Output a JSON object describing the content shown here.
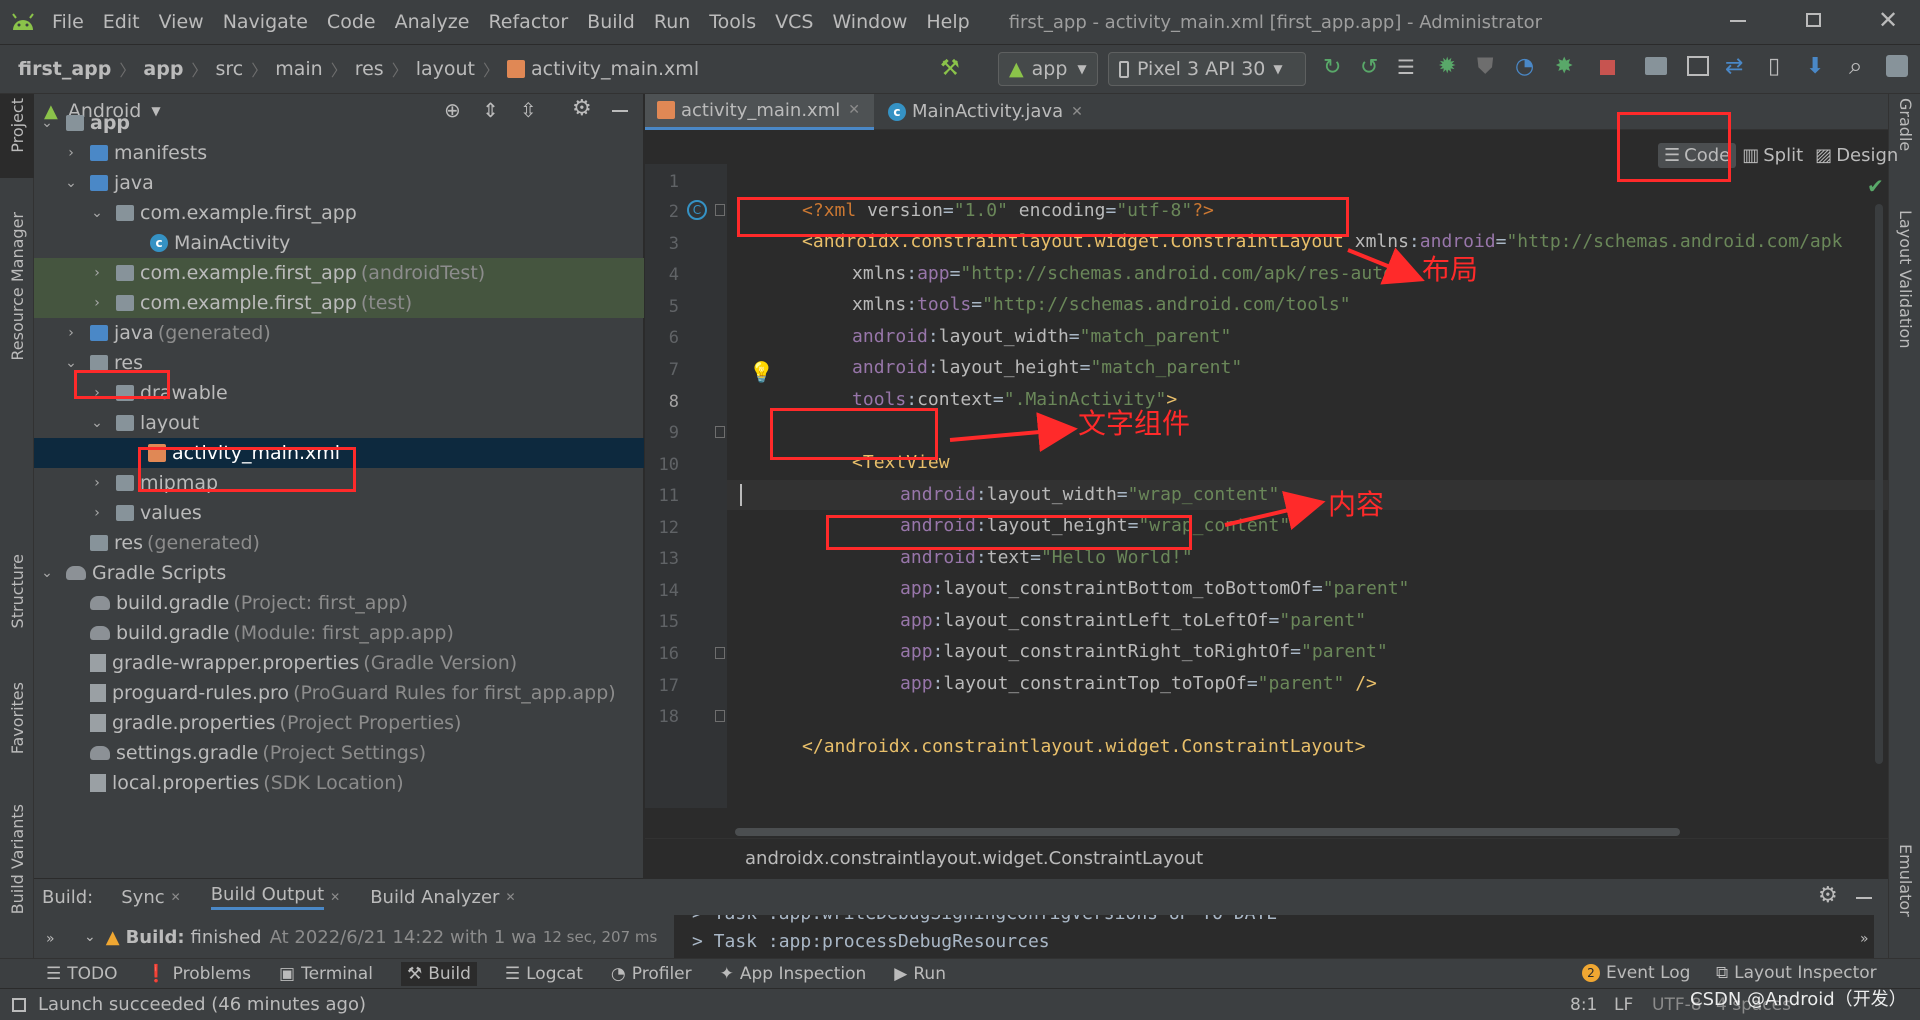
{
  "menu": {
    "items": [
      "File",
      "Edit",
      "View",
      "Navigate",
      "Code",
      "Analyze",
      "Refactor",
      "Build",
      "Run",
      "Tools",
      "VCS",
      "Window",
      "Help"
    ],
    "title": "first_app - activity_main.xml [first_app.app] - Administrator"
  },
  "breadcrumb": [
    "first_app",
    "app",
    "src",
    "main",
    "res",
    "layout",
    "activity_main.xml"
  ],
  "toolbar": {
    "run_config": "app",
    "device": "Pixel 3 API 30"
  },
  "left_tool_windows": [
    "Project",
    "Resource Manager",
    "Structure",
    "Favorites",
    "Build Variants"
  ],
  "right_tool_windows": [
    "Gradle",
    "Layout Validation",
    "Emulator"
  ],
  "project_panel": {
    "view": "Android",
    "tree": [
      {
        "label": "app",
        "dim": ""
      },
      {
        "label": "manifests",
        "dim": ""
      },
      {
        "label": "java",
        "dim": ""
      },
      {
        "label": "com.example.first_app",
        "dim": ""
      },
      {
        "label": "MainActivity",
        "dim": ""
      },
      {
        "label": "com.example.first_app",
        "dim": "(androidTest)"
      },
      {
        "label": "com.example.first_app",
        "dim": "(test)"
      },
      {
        "label": "java",
        "dim": "(generated)"
      },
      {
        "label": "res",
        "dim": ""
      },
      {
        "label": "drawable",
        "dim": ""
      },
      {
        "label": "layout",
        "dim": ""
      },
      {
        "label": "activity_main.xml",
        "dim": ""
      },
      {
        "label": "mipmap",
        "dim": ""
      },
      {
        "label": "values",
        "dim": ""
      },
      {
        "label": "res",
        "dim": "(generated)"
      },
      {
        "label": "Gradle Scripts",
        "dim": ""
      },
      {
        "label": "build.gradle",
        "dim": "(Project: first_app)"
      },
      {
        "label": "build.gradle",
        "dim": "(Module: first_app.app)"
      },
      {
        "label": "gradle-wrapper.properties",
        "dim": "(Gradle Version)"
      },
      {
        "label": "proguard-rules.pro",
        "dim": "(ProGuard Rules for first_app.app)"
      },
      {
        "label": "gradle.properties",
        "dim": "(Project Properties)"
      },
      {
        "label": "settings.gradle",
        "dim": "(Project Settings)"
      },
      {
        "label": "local.properties",
        "dim": "(SDK Location)"
      }
    ]
  },
  "editor": {
    "tabs": [
      "activity_main.xml",
      "MainActivity.java"
    ],
    "view_modes": [
      "Code",
      "Split",
      "Design"
    ],
    "line_numbers": [
      "1",
      "2",
      "3",
      "4",
      "5",
      "6",
      "7",
      "8",
      "9",
      "10",
      "11",
      "12",
      "13",
      "14",
      "15",
      "16",
      "17",
      "18"
    ],
    "code": {
      "l1": {
        "a": "<?xml ",
        "b": "version",
        "c": "=",
        "d": "\"1.0\"",
        "e": " encoding",
        "f": "=",
        "g": "\"utf-8\"",
        "h": "?>"
      },
      "l2": {
        "tag": "<androidx.constraintlayout.widget.ConstraintLayout",
        "ns": " xmlns",
        "col": ":",
        "attr": "android",
        "eq": "=",
        "val": "\"http://schemas.android.com/apk"
      },
      "l3": {
        "ns": "xmlns",
        "col": ":",
        "attr": "app",
        "eq": "=",
        "val": "\"http://schemas.android.com/apk/res-auto\""
      },
      "l4": {
        "ns": "xmlns",
        "col": ":",
        "attr": "tools",
        "eq": "=",
        "val": "\"http://schemas.android.com/tools\""
      },
      "l5": {
        "ns": "android",
        "col": ":",
        "attr": "layout_width",
        "eq": "=",
        "val": "\"match_parent\""
      },
      "l6": {
        "ns": "android",
        "col": ":",
        "attr": "layout_height",
        "eq": "=",
        "val": "\"match_parent\""
      },
      "l7": {
        "ns": "tools",
        "col": ":",
        "attr": "context",
        "eq": "=",
        "val": "\".MainActivity\"",
        "tag": ">"
      },
      "l9": {
        "tag": "<TextView"
      },
      "l10": {
        "ns": "android",
        "col": ":",
        "attr": "layout_width",
        "eq": "=",
        "val": "\"wrap_content\""
      },
      "l11": {
        "ns": "android",
        "col": ":",
        "attr": "layout_height",
        "eq": "=",
        "val": "\"wrap_content\""
      },
      "l12": {
        "ns": "android",
        "col": ":",
        "attr": "text",
        "eq": "=",
        "val": "\"Hello World!\""
      },
      "l13": {
        "ns": "app",
        "col": ":",
        "attr": "layout_constraintBottom_toBottomOf",
        "eq": "=",
        "val": "\"parent\""
      },
      "l14": {
        "ns": "app",
        "col": ":",
        "attr": "layout_constraintLeft_toLeftOf",
        "eq": "=",
        "val": "\"parent\""
      },
      "l15": {
        "ns": "app",
        "col": ":",
        "attr": "layout_constraintRight_toRightOf",
        "eq": "=",
        "val": "\"parent\""
      },
      "l16": {
        "ns": "app",
        "col": ":",
        "attr": "layout_constraintTop_toTopOf",
        "eq": "=",
        "val": "\"parent\"",
        "tag": " />"
      },
      "l18": {
        "tag": "</androidx.constraintlayout.widget.ConstraintLayout>"
      }
    },
    "status_path": "androidx.constraintlayout.widget.ConstraintLayout"
  },
  "annotations": {
    "layout": "布局",
    "textview": "文字组件",
    "content": "内容"
  },
  "build_panel": {
    "label": "Build:",
    "tabs": [
      "Sync",
      "Build Output",
      "Build Analyzer"
    ],
    "status_bold": "Build:",
    "status": "finished",
    "status_detail": "At 2022/6/21 14:22 with 1 wa",
    "status_time": "12 sec, 207 ms",
    "log_top": "> Task :app:writeDebugSigningConfigVersions UP-TO-DATE",
    "log": "> Task :app:processDebugResources"
  },
  "bottom_tools": {
    "left": [
      "TODO",
      "Problems",
      "Terminal",
      "Build",
      "Logcat",
      "Profiler",
      "App Inspection",
      "Run"
    ],
    "event_log_count": "2",
    "right": [
      "Event Log",
      "Layout Inspector"
    ]
  },
  "status_bar": {
    "message": "Launch succeeded (46 minutes ago)",
    "position": "8:1",
    "line_sep": "LF",
    "encoding": "UTF-8",
    "indent": "4 spaces",
    "watermark": "CSDN @Android（开发）"
  },
  "colors": {
    "accent": "#4a88c7",
    "annotation": "#ff2a2a",
    "tag": "#e8bf6a",
    "namespace": "#9876aa",
    "value": "#6a8759"
  }
}
